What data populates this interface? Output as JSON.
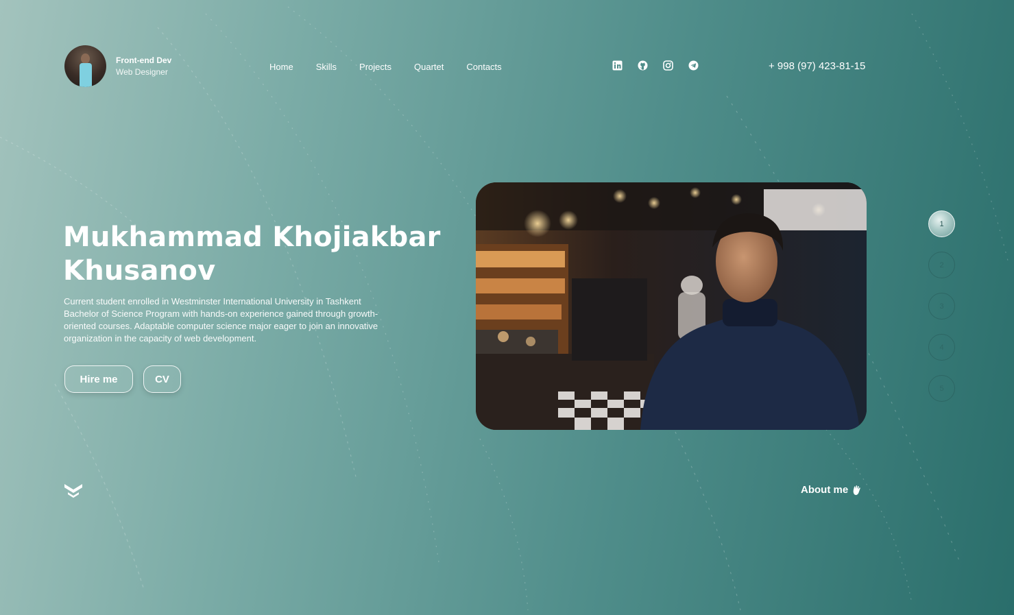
{
  "header": {
    "brand_title": "Front-end Dev",
    "brand_subtitle": "Web Designer",
    "nav": [
      "Home",
      "Skills",
      "Projects",
      "Quartet",
      "Contacts"
    ],
    "socials": [
      "linkedin-icon",
      "github-icon",
      "instagram-icon",
      "telegram-icon"
    ],
    "phone": "+ 998 (97) 423-81-15"
  },
  "hero": {
    "name": "Mukhammad Khojiakbar Khusanov",
    "description": "Current student enrolled in Westminster International University in Tashkent Bachelor of Science Program with hands-on experience gained through growth-oriented courses. Adaptable computer science major eager to join an innovative organization in the capacity of web development.",
    "hire_label": "Hire me",
    "cv_label": "CV"
  },
  "pager": {
    "pages": [
      "1",
      "2",
      "3",
      "4",
      "5"
    ],
    "active": "1"
  },
  "footer": {
    "logo": "logo-mark-icon",
    "about_label": "About me",
    "about_icon": "waving-hand-icon"
  },
  "colors": {
    "background_start": "#a3c3bd",
    "background_end": "#2a6e6b",
    "text": "#ffffff"
  }
}
